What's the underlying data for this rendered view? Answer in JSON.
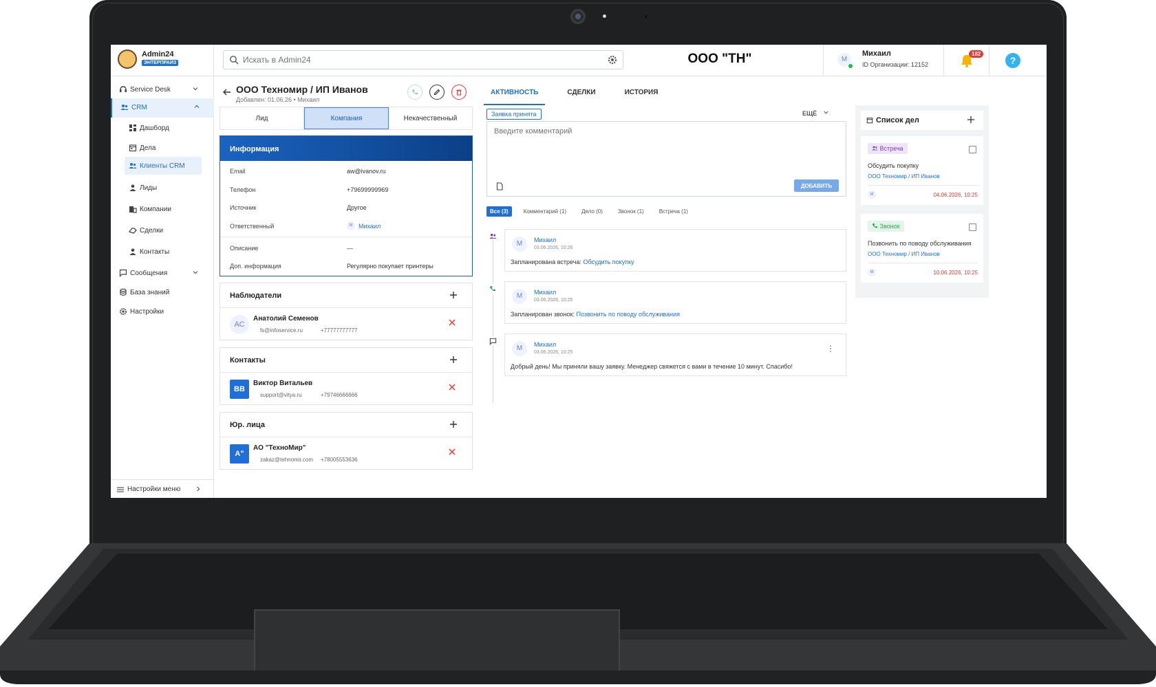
{
  "topbar": {
    "brand_name": "Admin24",
    "brand_badge": "ЭНТЕРПРАЙЗ",
    "search_placeholder": "Искать в Admin24",
    "org_title": "ООО \"ТН\"",
    "user_initial": "M",
    "user_name": "Михаил",
    "org_id": "ID Организации: 12152",
    "notifications": "182",
    "help": "?"
  },
  "sidebar": {
    "items": [
      {
        "label": "Service Desk"
      },
      {
        "label": "CRM"
      },
      {
        "label": "Дашборд"
      },
      {
        "label": "Дела"
      },
      {
        "label": "Клиенты CRM"
      },
      {
        "label": "Лиды"
      },
      {
        "label": "Компании"
      },
      {
        "label": "Сделки"
      },
      {
        "label": "Контакты"
      },
      {
        "label": "Сообщения"
      },
      {
        "label": "База знаний"
      },
      {
        "label": "Настройки"
      }
    ],
    "footer": "Настройки меню"
  },
  "header": {
    "title": "ООО Техномир / ИП Иванов",
    "subtitle": "Добавлен: 01.06.26 • Михаил"
  },
  "segments": [
    "Лид",
    "Компания",
    "Некачественный"
  ],
  "info": {
    "title": "Информация",
    "rows": [
      {
        "label": "Email",
        "value": "aw@ivanov.ru"
      },
      {
        "label": "Телефон",
        "value": "+79699999969"
      },
      {
        "label": "Источник",
        "value": "Другое"
      },
      {
        "label": "Ответственный",
        "value": "Михаил"
      },
      {
        "label": "Описание",
        "value": "—"
      },
      {
        "label": "Доп. информация",
        "value": "Регулярно покупает принтеры"
      }
    ],
    "resp_initial": "M"
  },
  "observers": {
    "title": "Наблюдатели",
    "person": {
      "initials": "АС",
      "name": "Анатолий Семенов",
      "email": "fs@infoservice.ru",
      "phone": "+77777777777"
    }
  },
  "contacts": {
    "title": "Контакты",
    "person": {
      "initials": "ВВ",
      "name": "Виктор Витальев",
      "email": "support@vitya.ru",
      "phone": "+79746666666"
    }
  },
  "legal": {
    "title": "Юр. лица",
    "person": {
      "initials": "А\"",
      "name": "АО \"ТехноМир\"",
      "email": "zakaz@tehnomir.com",
      "phone": "+78005553636"
    }
  },
  "activity": {
    "tabs": [
      "АКТИВНОСТЬ",
      "СДЕЛКИ",
      "ИСТОРИЯ"
    ],
    "status_chip": "Заявка принята",
    "more": "ЕЩЁ",
    "comment_placeholder": "Введите комментарий",
    "add_button": "ДОБАВИТЬ",
    "filters": [
      "Все (3)",
      "Комментарий (1)",
      "Дело (0)",
      "Звонок (1)",
      "Встреча (1)"
    ],
    "items": [
      {
        "initial": "M",
        "author": "Михаил",
        "date": "03.06.2026, 10:26",
        "text": "Запланирована встреча: ",
        "link": "Обсудить покупку"
      },
      {
        "initial": "M",
        "author": "Михаил",
        "date": "03.06.2026, 10:25",
        "text": "Запланирован звонок: ",
        "link": "Позвонить по поводу обслуживания"
      },
      {
        "initial": "M",
        "author": "Михаил",
        "date": "03.06.2026, 10:25",
        "text": "Добрый день! Мы приняли вашу заявку. Менеджер свяжется с вами в течение 10 минут. Спасибо!",
        "link": ""
      }
    ]
  },
  "todo": {
    "title": "Список дел",
    "items": [
      {
        "chip": "Встреча",
        "title": "Обсудить покупку",
        "link": "ООО Техномир / ИП Иванов",
        "initial": "M",
        "date": "04.06.2026, 10:25"
      },
      {
        "chip": "Звонок",
        "title": "Позвонить по поводу обслуживания",
        "link": "ООО Техномир / ИП Иванов",
        "initial": "M",
        "date": "10.06.2026, 10:25"
      }
    ]
  },
  "colors": {
    "accent": "#1f6fd6",
    "danger": "#e53935",
    "success": "#2ea44f",
    "meeting": "#7b3fc4"
  }
}
